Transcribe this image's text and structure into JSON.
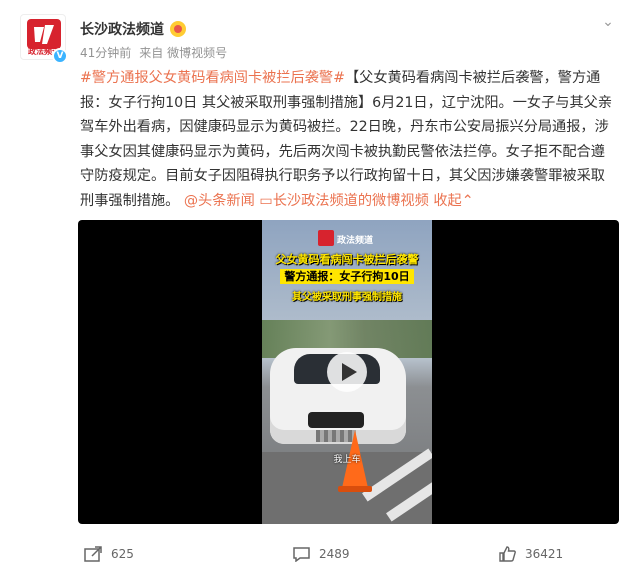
{
  "account": {
    "name": "长沙政法频道",
    "avatar_caption": "政法频道",
    "verified_icon": "verified-v-icon",
    "time": "41分钟前",
    "source": "来自 微博视频号"
  },
  "post": {
    "topic": "#警方通报父女黄码看病闯卡被拦后袭警#",
    "body_1": "【父女黄码看病闯卡被拦后袭警，警方通报：女子行拘10日 其父被采取刑事强制措施】6月21日，辽宁沈阳。一女子与其父亲驾车外出看病，因健康码显示为黄码被拦。22日晚，丹东市公安局振兴分局通报，涉事父女因其健康码显示为黄码，先后两次闯卡被执勤民警依法拦停。女子拒不配合遵守防疫规定。目前女子因阻碍执行职务予以行政拘留十日，其父因涉嫌袭警罪被采取刑事强制措施。",
    "at_link": "@头条新闻",
    "video_link": "长沙政法频道的微博视频",
    "collapse": "收起"
  },
  "video": {
    "brand": "政法频道",
    "caption_1": "父女黄码看病闯卡被拦后袭警",
    "caption_2": "警方通报：女子行拘10日",
    "caption_3": "其父被采取刑事强制措施",
    "subtitle": "我上车"
  },
  "actions": {
    "repost_count": "625",
    "comment_count": "2489",
    "like_count": "36421"
  },
  "colors": {
    "link": "#eb7350",
    "brand_red": "#d7232e"
  }
}
